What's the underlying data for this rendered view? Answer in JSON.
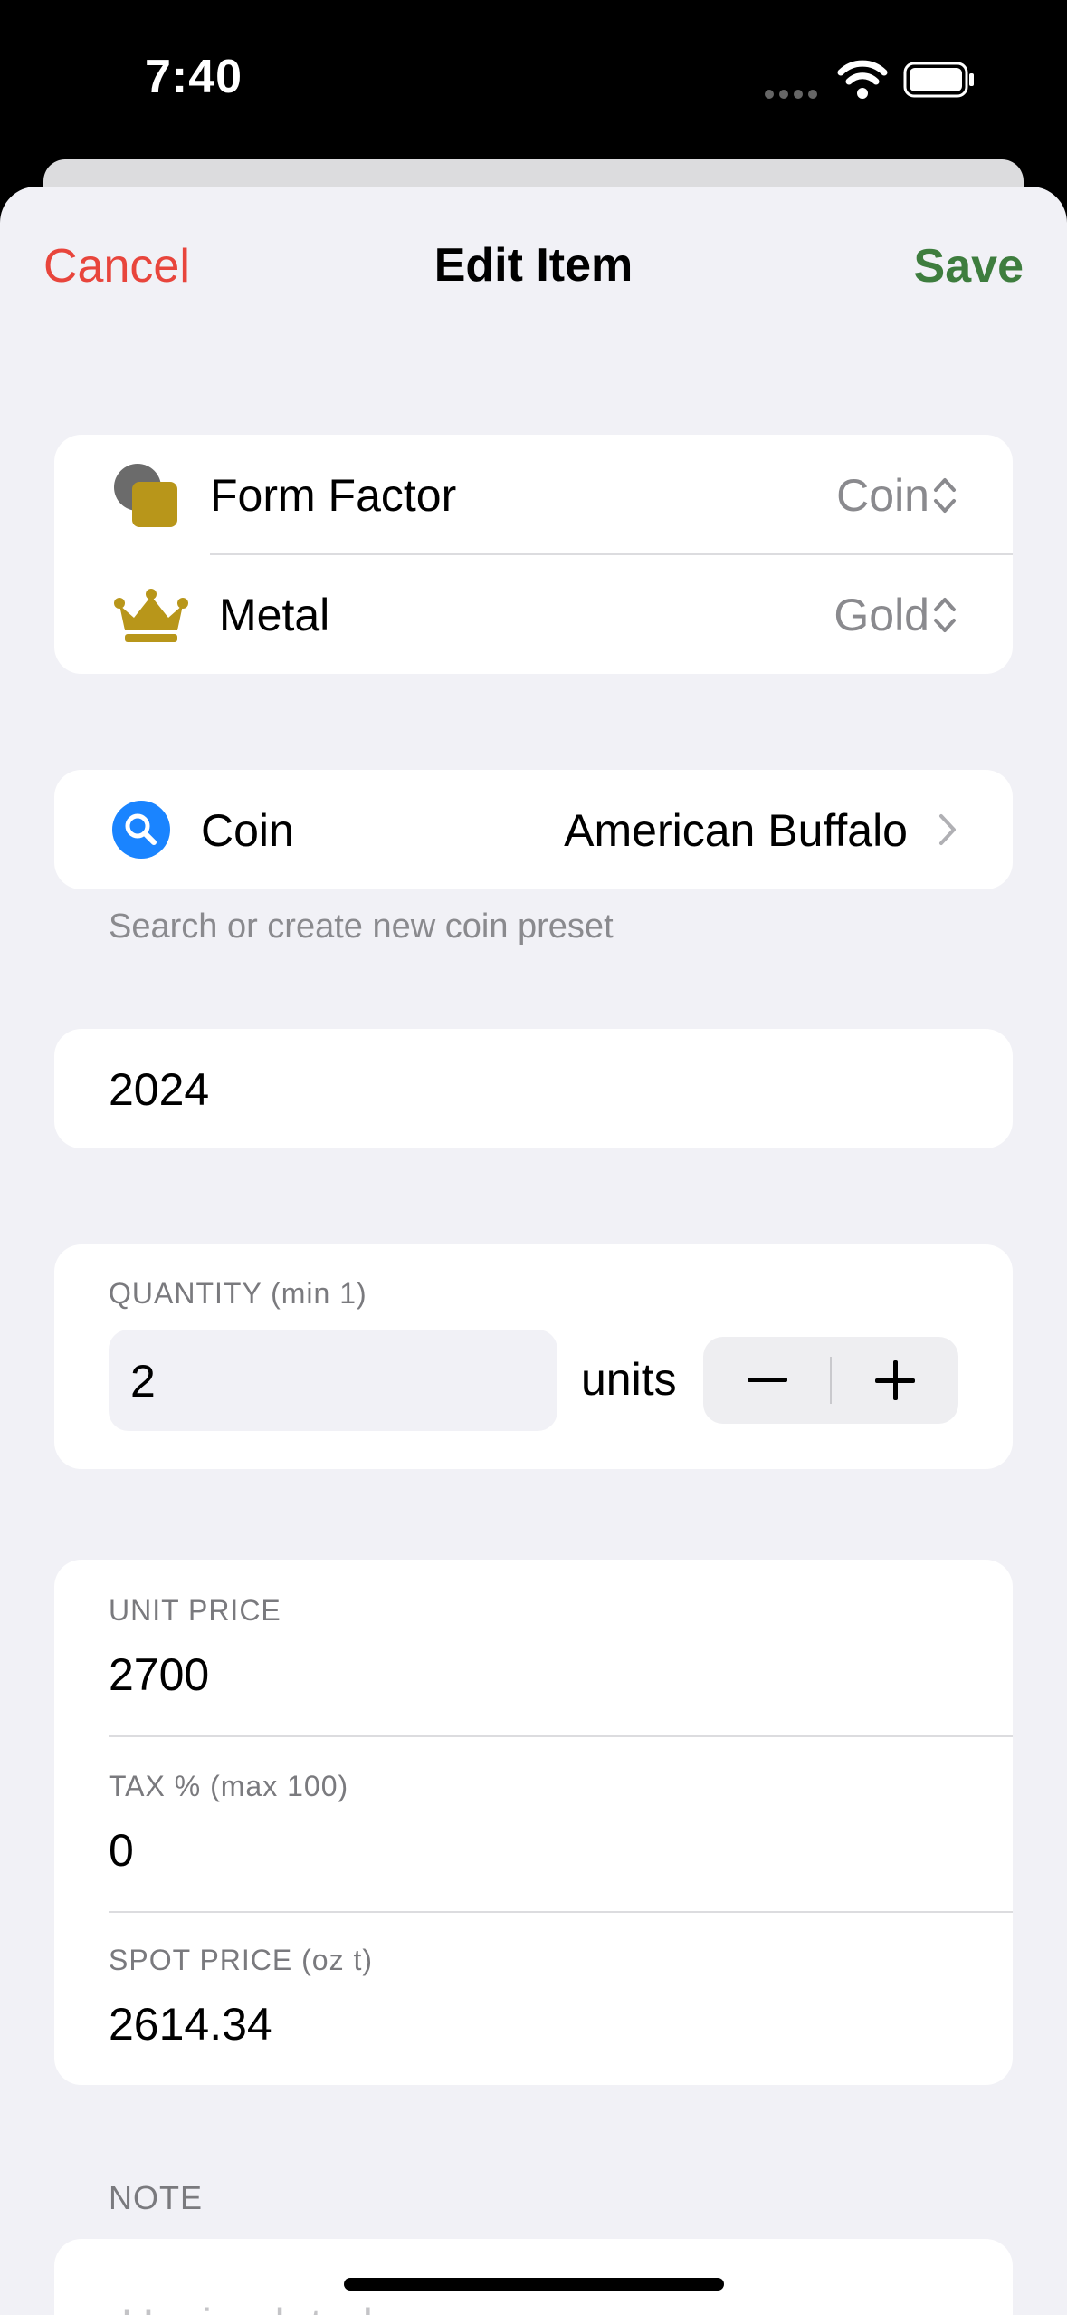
{
  "status_bar": {
    "time": "7:40"
  },
  "nav": {
    "cancel_label": "Cancel",
    "title": "Edit Item",
    "save_label": "Save"
  },
  "type_card": {
    "form_factor": {
      "label": "Form Factor",
      "value": "Coin",
      "icon": "form-factor-icon"
    },
    "metal": {
      "label": "Metal",
      "value": "Gold",
      "icon": "crown-icon"
    }
  },
  "coin_card": {
    "label": "Coin",
    "value": "American Buffalo",
    "caption": "Search or create new coin preset",
    "icon": "search-icon"
  },
  "year": {
    "value": "2024"
  },
  "quantity": {
    "label": "QUANTITY (min 1)",
    "value": "2",
    "units_label": "units",
    "minus": "−",
    "plus": "+"
  },
  "pricing": {
    "unit_price_label": "UNIT PRICE",
    "unit_price": "2700",
    "tax_label": "TAX % (max 100)",
    "tax": "0",
    "spot_label": "SPOT PRICE (oz t)",
    "spot": "2614.34"
  },
  "note": {
    "label": "NOTE",
    "placeholder": "Uncirculated"
  },
  "colors": {
    "cancel": "#e8453c",
    "save": "#3e7d3e",
    "gold": "#b8961a",
    "search_blue": "#1a84ff"
  }
}
